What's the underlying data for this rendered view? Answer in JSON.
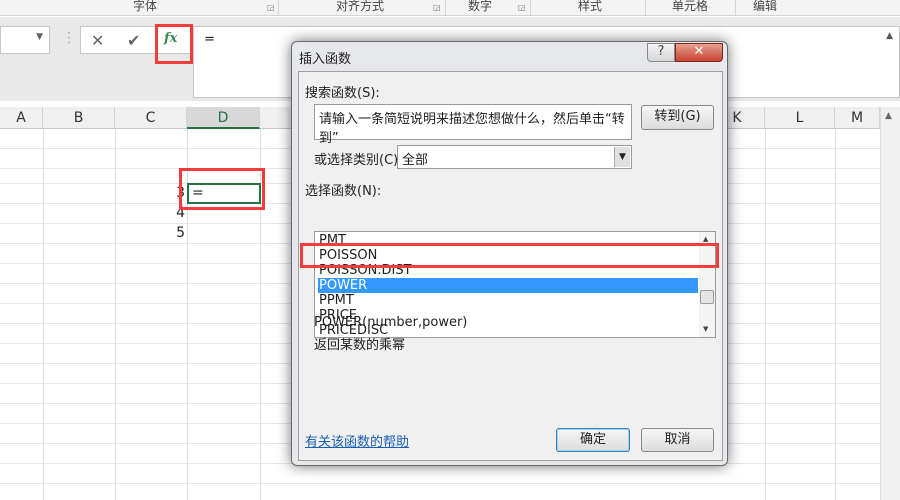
{
  "ribbon": {
    "groups": [
      "字体",
      "对齐方式",
      "数字",
      "样式",
      "单元格",
      "编辑"
    ]
  },
  "formula_bar": {
    "cancel_icon": "✕",
    "enter_icon": "✔",
    "fx_label": "fx",
    "content": "="
  },
  "columns": [
    "A",
    "B",
    "C",
    "D",
    "K",
    "L",
    "M"
  ],
  "cells": {
    "d_value": "=",
    "c_values": [
      "3",
      "4",
      "5"
    ]
  },
  "dialog": {
    "title": "插入函数",
    "help_icon": "?",
    "close_icon": "✕",
    "search_label": "搜索函数(S):",
    "search_value": "请输入一条简短说明来描述您想做什么，然后单击“转到”",
    "go_button": "转到(G)",
    "category_label": "或选择类别(C):",
    "category_value": "全部",
    "list_label": "选择函数(N):",
    "functions": [
      "PMT",
      "POISSON",
      "POISSON.DIST",
      "POWER",
      "PPMT",
      "PRICE",
      "PRICEDISC"
    ],
    "selected": "POWER",
    "signature": "POWER(number,power)",
    "description": "返回某数的乘幂",
    "help_link": "有关该函数的帮助",
    "ok_button": "确定",
    "cancel_button": "取消"
  },
  "colors": {
    "selection": "#3399ff",
    "highlight_red": "#f33c3c",
    "excel_green": "#217346"
  }
}
